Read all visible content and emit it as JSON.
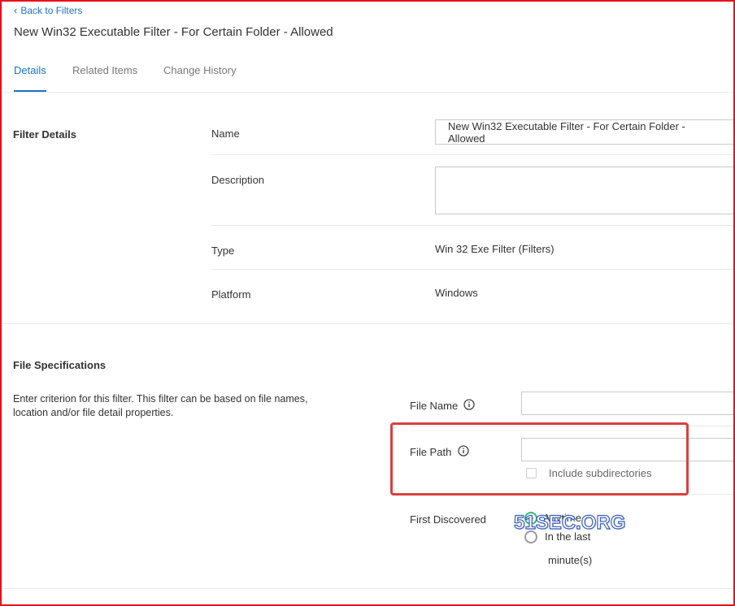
{
  "nav": {
    "back_label": "Back to Filters"
  },
  "page": {
    "title": "New Win32 Executable Filter - For Certain Folder - Allowed"
  },
  "tabs": [
    {
      "label": "Details",
      "active": true
    },
    {
      "label": "Related Items",
      "active": false
    },
    {
      "label": "Change History",
      "active": false
    }
  ],
  "filter_details": {
    "section_title": "Filter Details",
    "name_label": "Name",
    "name_value": "New Win32 Executable Filter - For Certain Folder - Allowed",
    "description_label": "Description",
    "description_value": "",
    "type_label": "Type",
    "type_value": "Win 32 Exe Filter (Filters)",
    "platform_label": "Platform",
    "platform_value": "Windows"
  },
  "file_specifications": {
    "section_title": "File Specifications",
    "description": "Enter criterion for this filter. This filter can be based on file names, location and/or file detail properties.",
    "file_name_label": "File Name",
    "file_name_value": "",
    "file_path_label": "File Path",
    "file_path_value": "",
    "include_subdirectories_label": "Include subdirectories",
    "include_subdirectories_checked": false,
    "first_discovered_label": "First Discovered",
    "first_discovered_options": [
      {
        "label": "Anytime",
        "selected": true
      },
      {
        "label": "In the last",
        "selected": false
      }
    ],
    "minutes_label": "minute(s)"
  },
  "watermark": "51SEC.ORG",
  "colors": {
    "accent": "#1a73c9",
    "highlight_box": "#d94040",
    "frame": "#e8101a",
    "radio_selected": "#3db587"
  },
  "icons": [
    "chevron-left-icon",
    "info-icon"
  ]
}
